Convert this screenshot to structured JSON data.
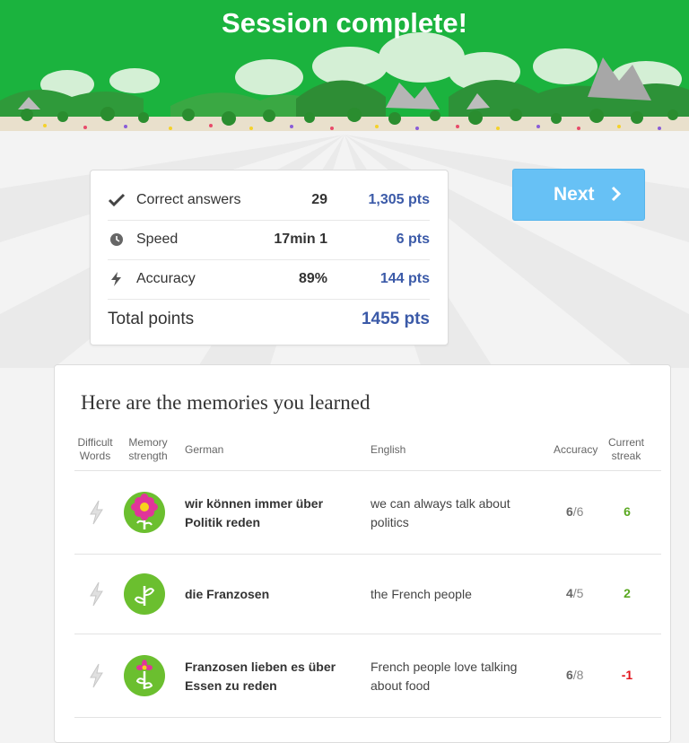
{
  "header": {
    "title": "Session complete!"
  },
  "stats": {
    "rows": [
      {
        "icon": "checkmark-icon",
        "label": "Correct answers",
        "value": "29",
        "points": "1,305 pts"
      },
      {
        "icon": "clock-icon",
        "label": "Speed",
        "value": "17min 1",
        "points": "6 pts"
      },
      {
        "icon": "lightning-icon",
        "label": "Accuracy",
        "value": "89%",
        "points": "144 pts"
      }
    ],
    "total_label": "Total points",
    "total_value": "1455 pts"
  },
  "next_button": {
    "label": "Next"
  },
  "memories": {
    "title": "Here are the memories you learned",
    "headers": {
      "difficult": "Difficult Words",
      "strength": "Memory strength",
      "german": "German",
      "english": "English",
      "accuracy": "Accuracy",
      "streak": "Current streak"
    },
    "rows": [
      {
        "german": "wir können immer über Politik reden",
        "english": "we can always talk about politics",
        "correct": "6",
        "total": "/6",
        "streak": "6",
        "strength": "flower-full-icon"
      },
      {
        "german": "die Franzosen",
        "english": "the French people",
        "correct": "4",
        "total": "/5",
        "streak": "2",
        "strength": "sprout-icon"
      },
      {
        "german": "Franzosen lieben es über Essen zu reden",
        "english": "French people love talking about food",
        "correct": "6",
        "total": "/8",
        "streak": "-1",
        "strength": "bud-icon"
      }
    ]
  },
  "colors": {
    "hero_green": "#1bb33e",
    "points_blue": "#3b5aa8",
    "next_blue": "#67c1f5",
    "streak_green": "#5aa821",
    "streak_red": "#e3121b"
  }
}
